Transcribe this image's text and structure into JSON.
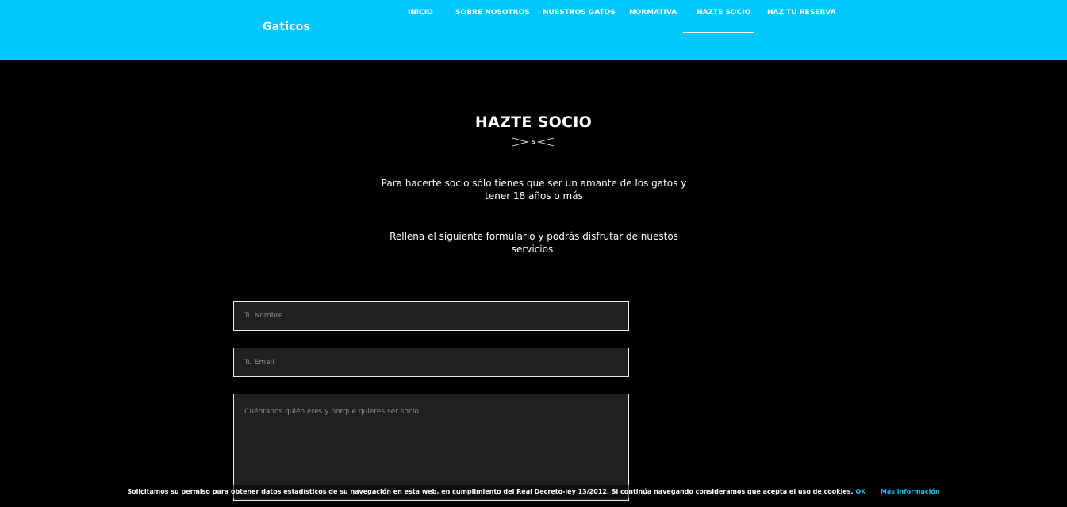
{
  "header": {
    "brand": "Gaticos",
    "nav": [
      {
        "label": "INICIO"
      },
      {
        "label": "SOBRE NOSOTROS"
      },
      {
        "label": "NUESTROS GATOS"
      },
      {
        "label": "NORMATIVA"
      },
      {
        "label": "HAZTE SOCIO",
        "active": true
      },
      {
        "label": "HAZ TU RESERVA"
      }
    ],
    "background_color": "#00c8ff"
  },
  "main": {
    "title": "HAZTE SOCIO",
    "divider_icon": "cat-whiskers-icon",
    "intro_1": "Para hacerte socio sólo tienes que ser un amante de los gatos y tener 18 años o más",
    "intro_2": "Rellena el siguiente formulario y podrás disfrutar de nuestos servicios:"
  },
  "form": {
    "name_placeholder": "Tu Nombre",
    "email_placeholder": "Tu Email",
    "message_placeholder": "Cuéntanos quién eres y porque quieres ser socio",
    "field_background": "#1f2022"
  },
  "cookie_bar": {
    "text": "Solicitamos su permiso para obtener datos estadísticos de su navegación en esta web, en cumplimiento del Real Decreto-ley 13/2012. Si continúa navegando consideramos que acepta el uso de cookies.",
    "ok_label": "OK",
    "separator": "|",
    "more_label": "Más información",
    "link_color": "#19b8e8"
  }
}
